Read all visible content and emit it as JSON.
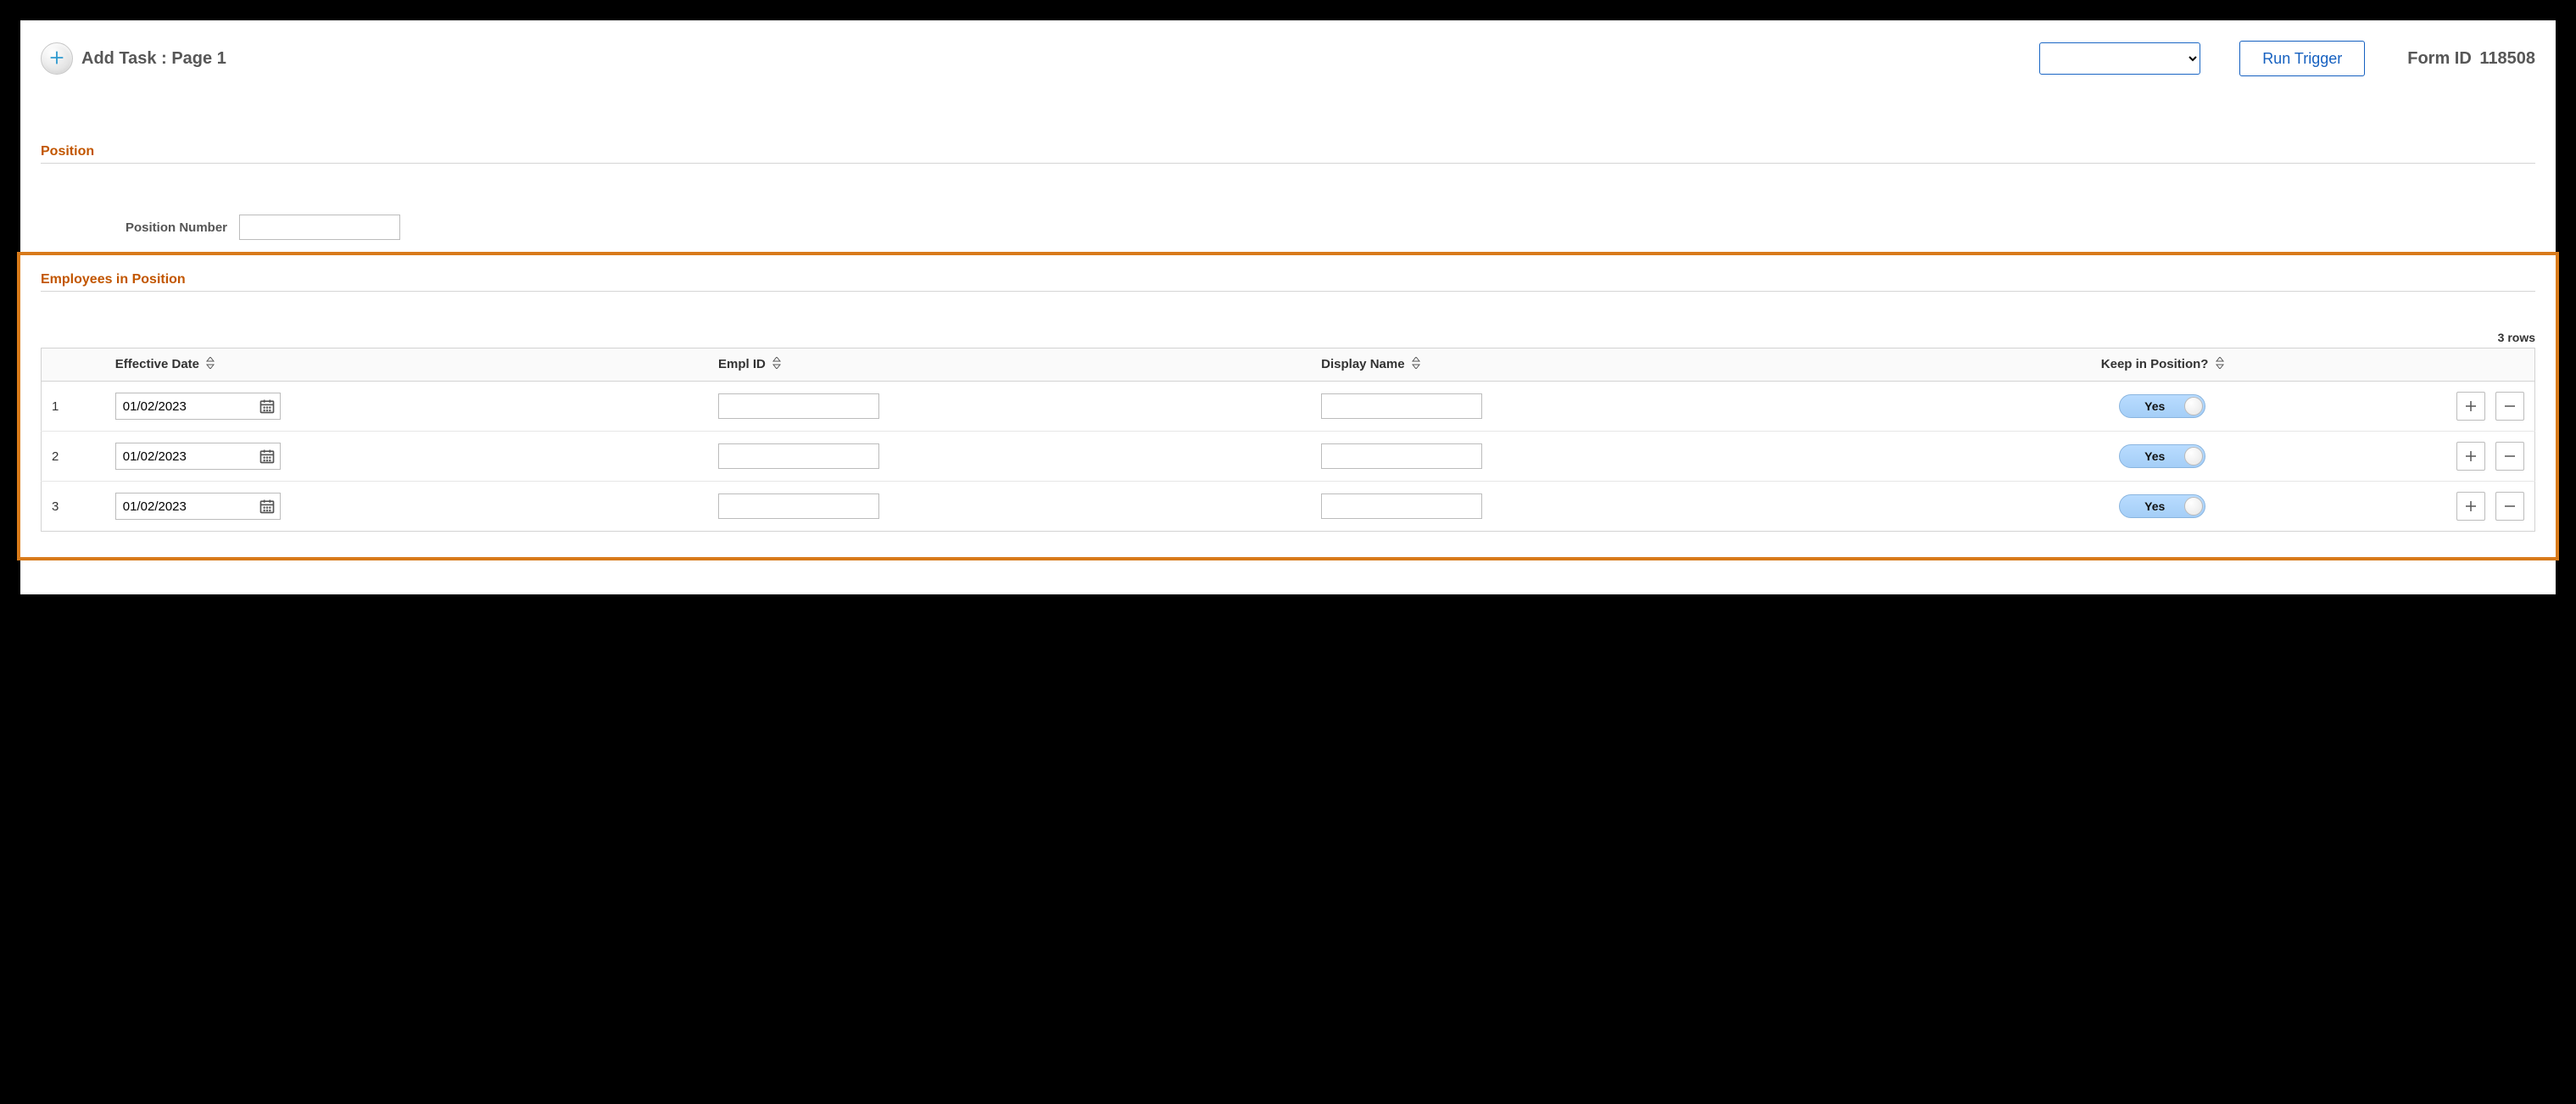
{
  "header": {
    "task_label": "Add Task :",
    "page_label": "Page 1",
    "trigger_select_value": "",
    "run_trigger_label": "Run Trigger",
    "form_id_label": "Form ID",
    "form_id_value": "118508"
  },
  "sections": {
    "position": {
      "heading": "Position",
      "field_label": "Position Number",
      "field_value": ""
    },
    "employees": {
      "heading": "Employees in Position",
      "rows_label": "3 rows",
      "columns": {
        "effective_date": "Effective Date",
        "empl_id": "Empl ID",
        "display_name": "Display Name",
        "keep_in_position": "Keep in Position?"
      },
      "toggle_yes_label": "Yes",
      "rows": [
        {
          "num": "1",
          "effective_date": "01/02/2023",
          "empl_id": "",
          "display_name": "",
          "keep": true
        },
        {
          "num": "2",
          "effective_date": "01/02/2023",
          "empl_id": "",
          "display_name": "",
          "keep": true
        },
        {
          "num": "3",
          "effective_date": "01/02/2023",
          "empl_id": "",
          "display_name": "",
          "keep": true
        }
      ]
    }
  }
}
